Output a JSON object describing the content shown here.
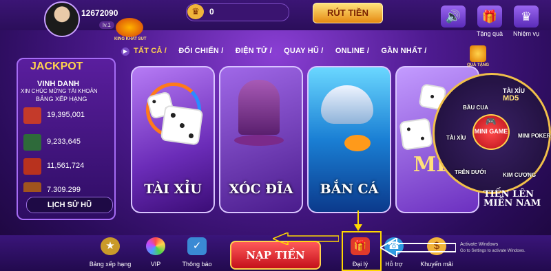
{
  "header": {
    "user_id": "12672090",
    "level": "lv.1",
    "logo_text": "KING KHAT SUT",
    "coins": "0",
    "coin_icon": "crown-icon",
    "withdraw_label": "RÚT TIỀN",
    "icons": [
      {
        "name": "sound-icon",
        "label": ""
      },
      {
        "name": "gift-icon",
        "label": "Tặng quà"
      },
      {
        "name": "crown-icon",
        "label": "Nhiệm vụ"
      }
    ]
  },
  "tabs": [
    "TẤT CẢ /",
    "ĐỐI CHIẾN /",
    "ĐIỆN TỬ /",
    "QUAY HŨ /",
    "ONLINE /",
    "GẦN NHẤT /"
  ],
  "jackpot": {
    "title": "JACKPOT",
    "honor": "VINH DANH",
    "congrats": "XIN CHÚC MỪNG TÀI KHOẢN",
    "ranking": "BẢNG XẾP HẠNG",
    "rows": [
      {
        "value": "19,395,001",
        "color": "#c43a2a"
      },
      {
        "value": "9,233,645",
        "color": "#2e6a3a"
      },
      {
        "value": "11,561,724",
        "color": "#b8321e"
      },
      {
        "value": "7,309,299",
        "color": "#a0541e"
      }
    ],
    "history_label": "LỊCH SỬ HŨ"
  },
  "games": [
    {
      "title": "TÀI XỈU"
    },
    {
      "title": "XÓC ĐĨA"
    },
    {
      "title": "BẮN CÁ"
    },
    {
      "title": "TÀI XỈU MD5"
    }
  ],
  "minigame": {
    "center": "MINI GAME",
    "items": [
      "BẦU CUA",
      "TÀI XỈU",
      "TÀI XỈU",
      "MD5",
      "MINI POKER",
      "TRÊN DƯỚI",
      "KIM CƯƠNG"
    ],
    "gift_label": "QUÀ TẶNG",
    "big_md5": "MD5",
    "mien_nam": "TIẾN LÊN MIỀN NAM"
  },
  "bottom": {
    "items": [
      {
        "label": "Bảng xếp hạng",
        "icon": "trophy-icon"
      },
      {
        "label": "VIP",
        "icon": "wheel-icon"
      },
      {
        "label": "Thông báo",
        "icon": "notification-icon"
      },
      {
        "label": "Đại lý",
        "icon": "gift-box-icon"
      },
      {
        "label": "Hỗ trợ",
        "icon": "support-icon"
      },
      {
        "label": "Khuyến mãi",
        "icon": "coin-icon"
      }
    ],
    "topup_label": "NẠP TIỀN",
    "activate_title": "Activate Windows",
    "activate_sub": "Go to Settings to activate Windows."
  },
  "colors": {
    "accent": "#ffd34d",
    "highlight": "#ffd800"
  }
}
